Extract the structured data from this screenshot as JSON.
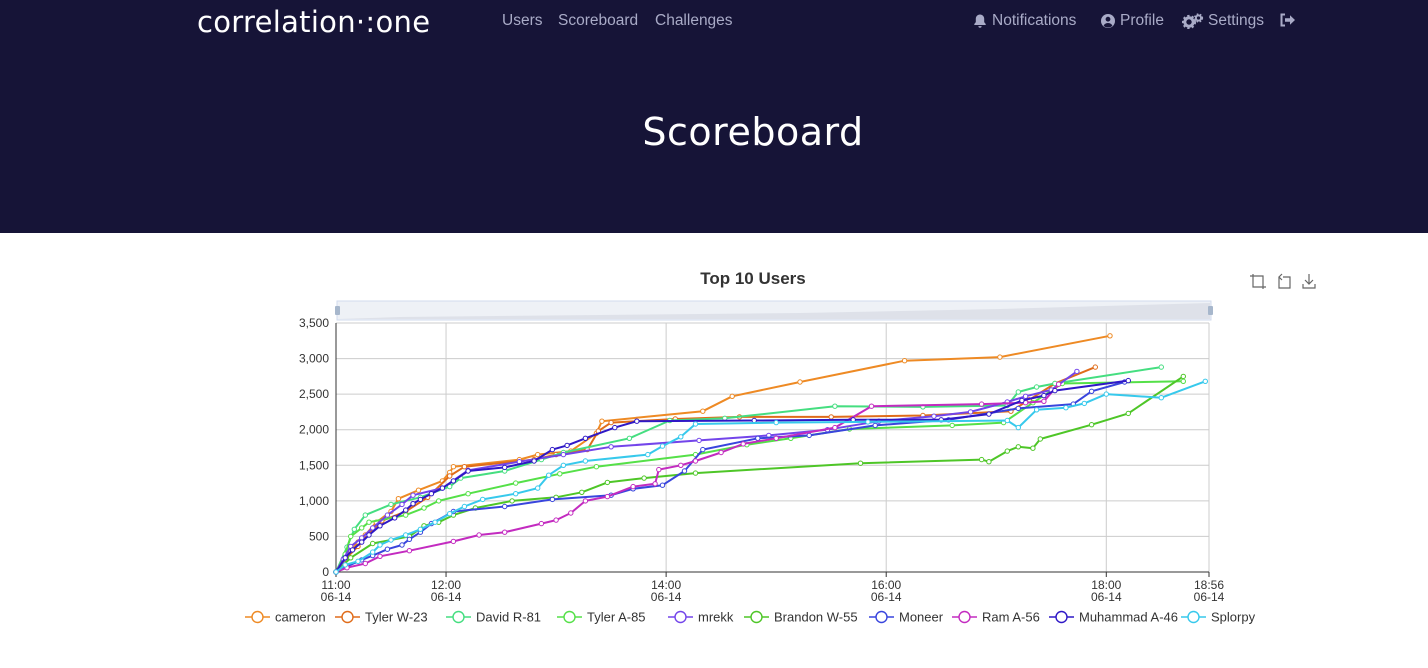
{
  "nav": {
    "logo": "correlation·:one",
    "links": [
      "Users",
      "Scoreboard",
      "Challenges"
    ],
    "notifications": "Notifications",
    "profile": "Profile",
    "settings": "Settings"
  },
  "page_title": "Scoreboard",
  "toolbox": [
    "zoom-icon",
    "zoom-reset-icon",
    "save-image-icon"
  ],
  "colors": {
    "header_bg": "#161437",
    "nav_text": "#a9abc7"
  },
  "chart_data": {
    "type": "line",
    "title": "Top 10 Users",
    "xlabel": "",
    "ylabel": "",
    "x_unit": "minutes after 11:00 on 06-14",
    "x_ticks": [
      {
        "t": 0,
        "label": "11:00\n06-14"
      },
      {
        "t": 60,
        "label": "12:00\n06-14"
      },
      {
        "t": 180,
        "label": "14:00\n06-14"
      },
      {
        "t": 300,
        "label": "16:00\n06-14"
      },
      {
        "t": 420,
        "label": "18:00\n06-14"
      },
      {
        "t": 476,
        "label": "18:56\n06-14"
      }
    ],
    "xlim": [
      0,
      476
    ],
    "ylim": [
      0,
      3500
    ],
    "y_ticks": [
      "0",
      "500",
      "1,000",
      "1,500",
      "2,000",
      "2,500",
      "3,000",
      "3,500"
    ],
    "grid": true,
    "legend_position": "bottom",
    "datazoom_slider": true,
    "series": [
      {
        "name": "cameron",
        "color": "#ee8a24",
        "points": [
          [
            0,
            0
          ],
          [
            4,
            150
          ],
          [
            8,
            300
          ],
          [
            12,
            420
          ],
          [
            16,
            520
          ],
          [
            22,
            700
          ],
          [
            30,
            850
          ],
          [
            34,
            1030
          ],
          [
            45,
            1150
          ],
          [
            58,
            1280
          ],
          [
            62,
            1400
          ],
          [
            64,
            1480
          ],
          [
            100,
            1580
          ],
          [
            110,
            1650
          ],
          [
            128,
            1700
          ],
          [
            142,
            1950
          ],
          [
            145,
            2120
          ],
          [
            200,
            2260
          ],
          [
            216,
            2470
          ],
          [
            253,
            2670
          ],
          [
            310,
            2970
          ],
          [
            362,
            3020
          ],
          [
            422,
            3320
          ]
        ]
      },
      {
        "name": "Tyler W-23",
        "color": "#e06c1a",
        "points": [
          [
            0,
            0
          ],
          [
            5,
            180
          ],
          [
            12,
            360
          ],
          [
            17,
            520
          ],
          [
            25,
            720
          ],
          [
            38,
            850
          ],
          [
            50,
            1050
          ],
          [
            62,
            1350
          ],
          [
            70,
            1480
          ],
          [
            108,
            1580
          ],
          [
            120,
            1650
          ],
          [
            137,
            1720
          ],
          [
            143,
            1980
          ],
          [
            150,
            2100
          ],
          [
            185,
            2150
          ],
          [
            220,
            2180
          ],
          [
            270,
            2180
          ],
          [
            320,
            2200
          ],
          [
            368,
            2260
          ],
          [
            378,
            2420
          ],
          [
            392,
            2650
          ],
          [
            414,
            2880
          ]
        ]
      },
      {
        "name": "David R-81",
        "color": "#45de80",
        "points": [
          [
            0,
            0
          ],
          [
            6,
            350
          ],
          [
            10,
            600
          ],
          [
            16,
            800
          ],
          [
            30,
            950
          ],
          [
            46,
            1050
          ],
          [
            62,
            1200
          ],
          [
            68,
            1320
          ],
          [
            92,
            1420
          ],
          [
            112,
            1580
          ],
          [
            124,
            1680
          ],
          [
            160,
            1880
          ],
          [
            182,
            2130
          ],
          [
            212,
            2160
          ],
          [
            272,
            2330
          ],
          [
            320,
            2320
          ],
          [
            366,
            2340
          ],
          [
            372,
            2530
          ],
          [
            382,
            2600
          ],
          [
            392,
            2650
          ],
          [
            450,
            2880
          ]
        ]
      },
      {
        "name": "Tyler A-85",
        "color": "#55e048",
        "points": [
          [
            0,
            0
          ],
          [
            5,
            250
          ],
          [
            8,
            500
          ],
          [
            14,
            620
          ],
          [
            18,
            700
          ],
          [
            38,
            800
          ],
          [
            48,
            900
          ],
          [
            56,
            1000
          ],
          [
            72,
            1100
          ],
          [
            98,
            1250
          ],
          [
            122,
            1380
          ],
          [
            142,
            1480
          ],
          [
            196,
            1650
          ],
          [
            224,
            1790
          ],
          [
            248,
            1880
          ],
          [
            280,
            2010
          ],
          [
            336,
            2060
          ],
          [
            364,
            2100
          ],
          [
            380,
            2380
          ],
          [
            396,
            2650
          ],
          [
            462,
            2680
          ]
        ]
      },
      {
        "name": "mrekk",
        "color": "#7345ea",
        "points": [
          [
            0,
            0
          ],
          [
            4,
            180
          ],
          [
            8,
            360
          ],
          [
            14,
            480
          ],
          [
            20,
            620
          ],
          [
            28,
            800
          ],
          [
            36,
            950
          ],
          [
            42,
            1080
          ],
          [
            58,
            1180
          ],
          [
            72,
            1430
          ],
          [
            100,
            1550
          ],
          [
            124,
            1650
          ],
          [
            150,
            1760
          ],
          [
            198,
            1850
          ],
          [
            236,
            1920
          ],
          [
            268,
            2000
          ],
          [
            296,
            2120
          ],
          [
            326,
            2190
          ],
          [
            346,
            2250
          ],
          [
            366,
            2390
          ],
          [
            376,
            2470
          ],
          [
            390,
            2560
          ],
          [
            404,
            2820
          ]
        ]
      },
      {
        "name": "Brandon W-55",
        "color": "#4ec627",
        "points": [
          [
            0,
            0
          ],
          [
            8,
            200
          ],
          [
            20,
            400
          ],
          [
            40,
            500
          ],
          [
            48,
            650
          ],
          [
            56,
            700
          ],
          [
            64,
            800
          ],
          [
            76,
            900
          ],
          [
            96,
            1000
          ],
          [
            120,
            1050
          ],
          [
            134,
            1120
          ],
          [
            148,
            1260
          ],
          [
            168,
            1320
          ],
          [
            196,
            1390
          ],
          [
            286,
            1530
          ],
          [
            352,
            1580
          ],
          [
            356,
            1550
          ],
          [
            366,
            1700
          ],
          [
            372,
            1760
          ],
          [
            380,
            1740
          ],
          [
            384,
            1870
          ],
          [
            412,
            2070
          ],
          [
            432,
            2230
          ],
          [
            462,
            2750
          ]
        ]
      },
      {
        "name": "Moneer",
        "color": "#3945dd",
        "points": [
          [
            0,
            0
          ],
          [
            6,
            80
          ],
          [
            14,
            170
          ],
          [
            20,
            230
          ],
          [
            28,
            320
          ],
          [
            36,
            380
          ],
          [
            40,
            460
          ],
          [
            46,
            560
          ],
          [
            52,
            680
          ],
          [
            64,
            850
          ],
          [
            92,
            920
          ],
          [
            118,
            1020
          ],
          [
            150,
            1080
          ],
          [
            162,
            1170
          ],
          [
            178,
            1220
          ],
          [
            190,
            1420
          ],
          [
            200,
            1720
          ],
          [
            230,
            1880
          ],
          [
            258,
            1920
          ],
          [
            294,
            2060
          ],
          [
            334,
            2140
          ],
          [
            372,
            2300
          ],
          [
            402,
            2360
          ],
          [
            412,
            2540
          ],
          [
            430,
            2670
          ]
        ]
      },
      {
        "name": "Ram A-56",
        "color": "#c32bc0",
        "points": [
          [
            0,
            0
          ],
          [
            6,
            60
          ],
          [
            16,
            120
          ],
          [
            24,
            220
          ],
          [
            40,
            300
          ],
          [
            64,
            430
          ],
          [
            78,
            520
          ],
          [
            92,
            560
          ],
          [
            112,
            680
          ],
          [
            120,
            730
          ],
          [
            128,
            830
          ],
          [
            136,
            1000
          ],
          [
            148,
            1060
          ],
          [
            162,
            1200
          ],
          [
            174,
            1240
          ],
          [
            176,
            1440
          ],
          [
            188,
            1500
          ],
          [
            196,
            1560
          ],
          [
            210,
            1680
          ],
          [
            222,
            1800
          ],
          [
            240,
            1880
          ],
          [
            272,
            2030
          ],
          [
            292,
            2330
          ],
          [
            352,
            2360
          ],
          [
            376,
            2380
          ],
          [
            386,
            2400
          ],
          [
            394,
            2640
          ]
        ]
      },
      {
        "name": "Muhammad A-46",
        "color": "#2f18c6",
        "points": [
          [
            0,
            0
          ],
          [
            5,
            200
          ],
          [
            9,
            310
          ],
          [
            14,
            420
          ],
          [
            18,
            520
          ],
          [
            24,
            650
          ],
          [
            32,
            760
          ],
          [
            38,
            870
          ],
          [
            42,
            960
          ],
          [
            46,
            1020
          ],
          [
            52,
            1100
          ],
          [
            58,
            1180
          ],
          [
            64,
            1280
          ],
          [
            72,
            1420
          ],
          [
            92,
            1470
          ],
          [
            108,
            1560
          ],
          [
            118,
            1720
          ],
          [
            126,
            1780
          ],
          [
            136,
            1880
          ],
          [
            152,
            2030
          ],
          [
            164,
            2120
          ],
          [
            228,
            2130
          ],
          [
            282,
            2140
          ],
          [
            330,
            2140
          ],
          [
            356,
            2220
          ],
          [
            374,
            2410
          ],
          [
            386,
            2480
          ],
          [
            392,
            2550
          ],
          [
            432,
            2690
          ]
        ]
      },
      {
        "name": "Splorpy",
        "color": "#37c9ec",
        "points": [
          [
            0,
            0
          ],
          [
            5,
            100
          ],
          [
            12,
            150
          ],
          [
            20,
            280
          ],
          [
            24,
            380
          ],
          [
            30,
            450
          ],
          [
            38,
            520
          ],
          [
            46,
            600
          ],
          [
            54,
            700
          ],
          [
            62,
            820
          ],
          [
            70,
            920
          ],
          [
            80,
            1020
          ],
          [
            98,
            1100
          ],
          [
            110,
            1180
          ],
          [
            116,
            1360
          ],
          [
            124,
            1500
          ],
          [
            136,
            1560
          ],
          [
            170,
            1650
          ],
          [
            178,
            1770
          ],
          [
            188,
            1900
          ],
          [
            196,
            2080
          ],
          [
            240,
            2100
          ],
          [
            290,
            2110
          ],
          [
            366,
            2130
          ],
          [
            372,
            2030
          ],
          [
            382,
            2280
          ],
          [
            398,
            2310
          ],
          [
            408,
            2370
          ],
          [
            420,
            2500
          ],
          [
            450,
            2450
          ],
          [
            474,
            2680
          ]
        ]
      }
    ]
  }
}
